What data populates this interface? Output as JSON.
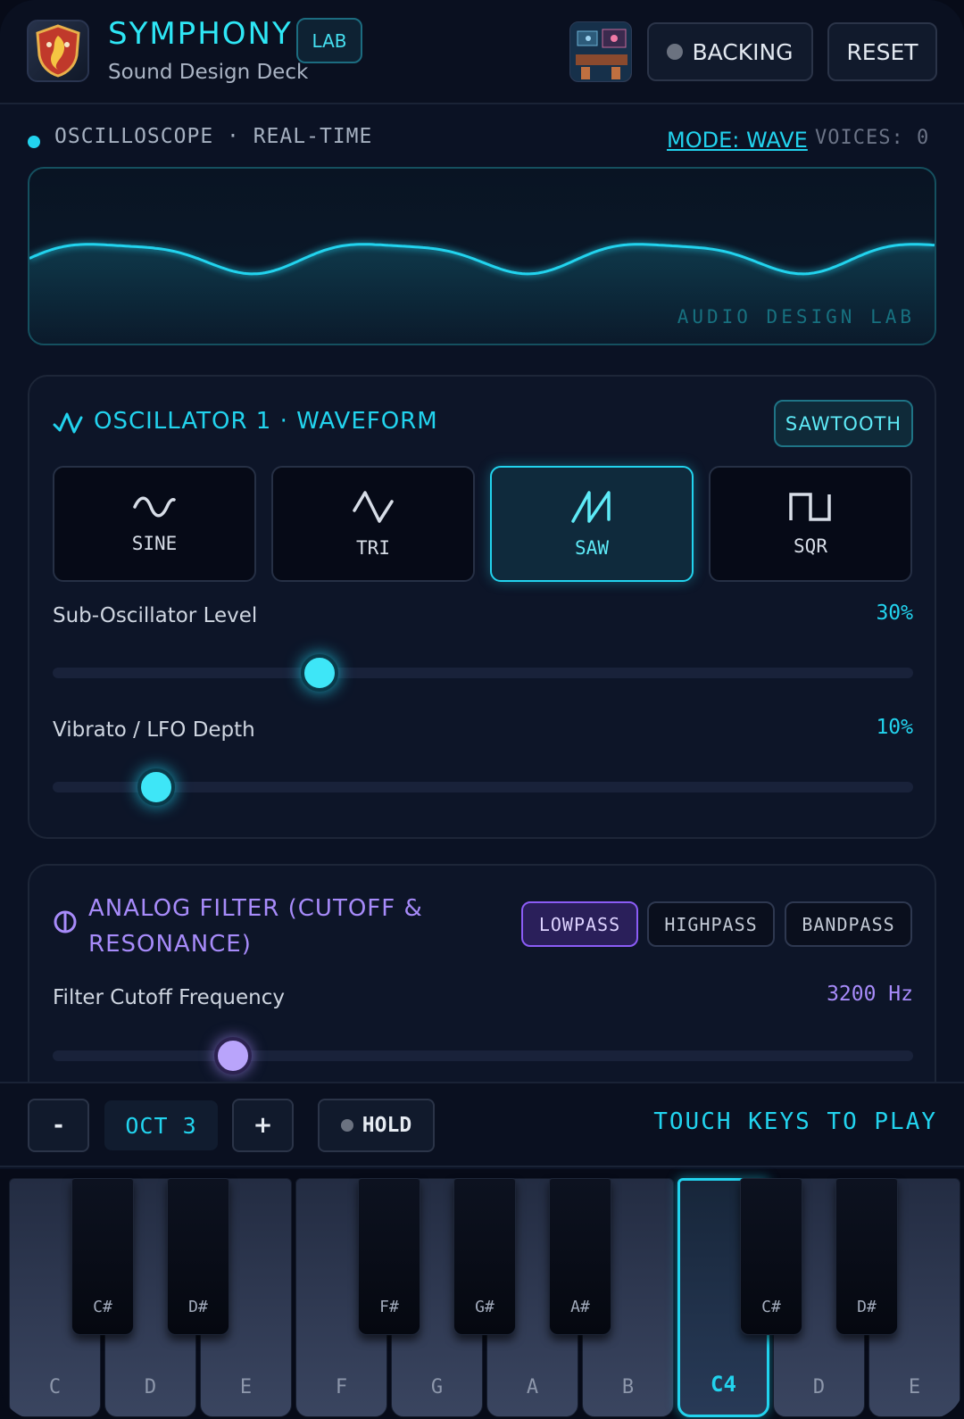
{
  "header": {
    "title": "SYMPHONY",
    "badge": "LAB",
    "subtitle": "Sound Design Deck",
    "backing_label": "BACKING",
    "reset_label": "RESET"
  },
  "scope": {
    "label": "OSCILLOSCOPE · REAL-TIME",
    "mode": "MODE: WAVE",
    "voices": "VOICES: 0",
    "watermark": "AUDIO DESIGN LAB"
  },
  "oscillator": {
    "title": "OSCILLATOR 1 · WAVEFORM",
    "selected_badge": "SAWTOOTH",
    "waveforms": [
      {
        "label": "SINE",
        "icon": "sine-wave-icon",
        "active": false
      },
      {
        "label": "TRI",
        "icon": "triangle-wave-icon",
        "active": false
      },
      {
        "label": "SAW",
        "icon": "saw-wave-icon",
        "active": true
      },
      {
        "label": "SQR",
        "icon": "square-wave-icon",
        "active": false
      }
    ],
    "sub_level": {
      "label": "Sub-Oscillator Level",
      "value_text": "30%",
      "fraction": 0.31
    },
    "vibrato": {
      "label": "Vibrato / LFO Depth",
      "value_text": "10%",
      "fraction": 0.12
    }
  },
  "filter": {
    "title": "ANALOG FILTER (CUTOFF & RESONANCE)",
    "types": [
      {
        "label": "LOWPASS",
        "active": true
      },
      {
        "label": "HIGHPASS",
        "active": false
      },
      {
        "label": "BANDPASS",
        "active": false
      }
    ],
    "cutoff": {
      "label": "Filter Cutoff Frequency",
      "value_text": "3200 Hz",
      "fraction": 0.21
    }
  },
  "octave": {
    "minus_label": "-",
    "display": "OCT 3",
    "plus_label": "+",
    "hold_label": "HOLD",
    "hint": "TOUCH KEYS TO PLAY"
  },
  "keyboard": {
    "white_keys": [
      {
        "label": "C",
        "active": false
      },
      {
        "label": "D",
        "active": false
      },
      {
        "label": "E",
        "active": false
      },
      {
        "label": "F",
        "active": false
      },
      {
        "label": "G",
        "active": false
      },
      {
        "label": "A",
        "active": false
      },
      {
        "label": "B",
        "active": false
      },
      {
        "label": "C4",
        "active": true
      },
      {
        "label": "D",
        "active": false
      },
      {
        "label": "E",
        "active": false
      }
    ],
    "black_keys": [
      "C#",
      "D#",
      "F#",
      "G#",
      "A#",
      "C#",
      "D#"
    ]
  },
  "colors": {
    "accent": "#22d3ee",
    "filter_accent": "#a78bfa",
    "background": "#0b1224"
  }
}
